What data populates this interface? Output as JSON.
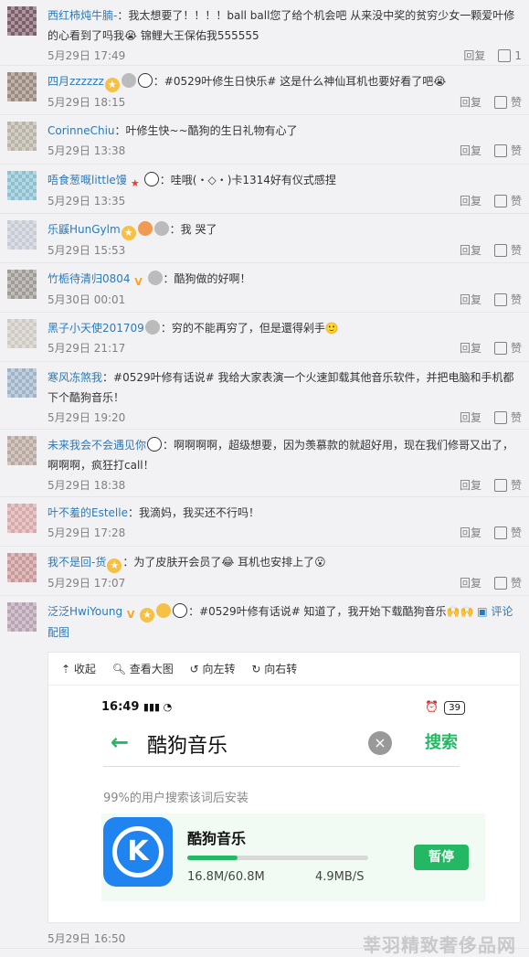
{
  "comments": [
    {
      "user": "西红柿炖牛腩-",
      "text": "：我太想要了！！！！ball  ball您了给个机会吧 从来没中奖的贫穷少女一颗爱叶修的心看到了吗我😭 锦鲤大王保佑我555555",
      "time": "5月29日 17:49",
      "reply": "回复",
      "like": "1",
      "avatar_color": "#7d5f6a"
    },
    {
      "user": "四月zzzzzz",
      "text": "：#0529叶修生日快乐# 这是什么神仙耳机也要好看了吧😭",
      "time": "5月29日 18:15",
      "reply": "回复",
      "like": "赞",
      "avatar_color": "#9b8a7e"
    },
    {
      "user": "CorinneChiu",
      "text": "：叶修生快~~酷狗的生日礼物有心了",
      "time": "5月29日 13:38",
      "reply": "回复",
      "like": "赞",
      "avatar_color": "#b9b3a8"
    },
    {
      "user": "唔食葱嘅little馒",
      "text": "：哇哦(・◇・)卡1314好有仪式感捏",
      "time": "5月29日 13:35",
      "reply": "回复",
      "like": "赞",
      "avatar_color": "#8cc0cf"
    },
    {
      "user": "乐鼷HunGylm",
      "text": "：我    哭了",
      "time": "5月29日 15:53",
      "reply": "回复",
      "like": "赞",
      "avatar_color": "#c8cbd6"
    },
    {
      "user": "竹栀待清归0804",
      "text": "：酷狗做的好啊！",
      "time": "5月30日 00:01",
      "reply": "回复",
      "like": "赞",
      "avatar_color": "#a09a96"
    },
    {
      "user": "黑子小天使201709",
      "text": "：穷的不能再穷了，但是還得剁手🙂",
      "time": "5月29日 21:17",
      "reply": "回复",
      "like": "赞",
      "avatar_color": "#cfcbc4"
    },
    {
      "user": "寒风冻煞我",
      "text": "：#0529叶修有话说# 我给大家表演一个火速卸载其他音乐软件，并把电脑和手机都下个酷狗音乐！",
      "time": "5月29日 19:20",
      "reply": "回复",
      "like": "赞",
      "avatar_color": "#9fb3c8"
    },
    {
      "user": "未来我会不会遇见你",
      "text": "：啊啊啊啊，超级想要，因为羡慕款的就超好用，现在我们修哥又出了，啊啊啊，疯狂打call！",
      "time": "5月29日 18:38",
      "reply": "回复",
      "like": "赞",
      "avatar_color": "#b9a9a0"
    },
    {
      "user": "叶不羞的Estelle",
      "text": "：我滴妈，我买还不行吗！",
      "time": "5月29日 17:28",
      "reply": "回复",
      "like": "赞",
      "avatar_color": "#d8a9aa"
    },
    {
      "user": "我不是回-货",
      "text": "：为了皮肤开会员了😂 耳机也安排上了😮",
      "time": "5月29日 17:07",
      "reply": "回复",
      "like": "赞",
      "avatar_color": "#c99898"
    },
    {
      "user": "泛泛HwiYoung",
      "text": "：#0529叶修有话说# 知道了，我开始下载酷狗音乐🙌🙌",
      "extra": "评论配图",
      "time": "5月29日 16:50",
      "reply": "回复",
      "like": "赞",
      "avatar_color": "#b8a3b3"
    }
  ],
  "image_toolbar": {
    "collapse": "收起",
    "view_large": "查看大图",
    "rotate_left": "向左转",
    "rotate_right": "向右转"
  },
  "phone": {
    "time": "16:49",
    "battery": "39",
    "query": "酷狗音乐",
    "search_button": "搜索",
    "hint": "99%的用户搜索该词后安装",
    "app_name": "酷狗音乐",
    "progress": 0.276,
    "size": "16.8M/60.8M",
    "speed": "4.9MB/S",
    "pause": "暂停",
    "logo_letter": "K"
  },
  "watermark": "莘羽精致奢侈品网"
}
